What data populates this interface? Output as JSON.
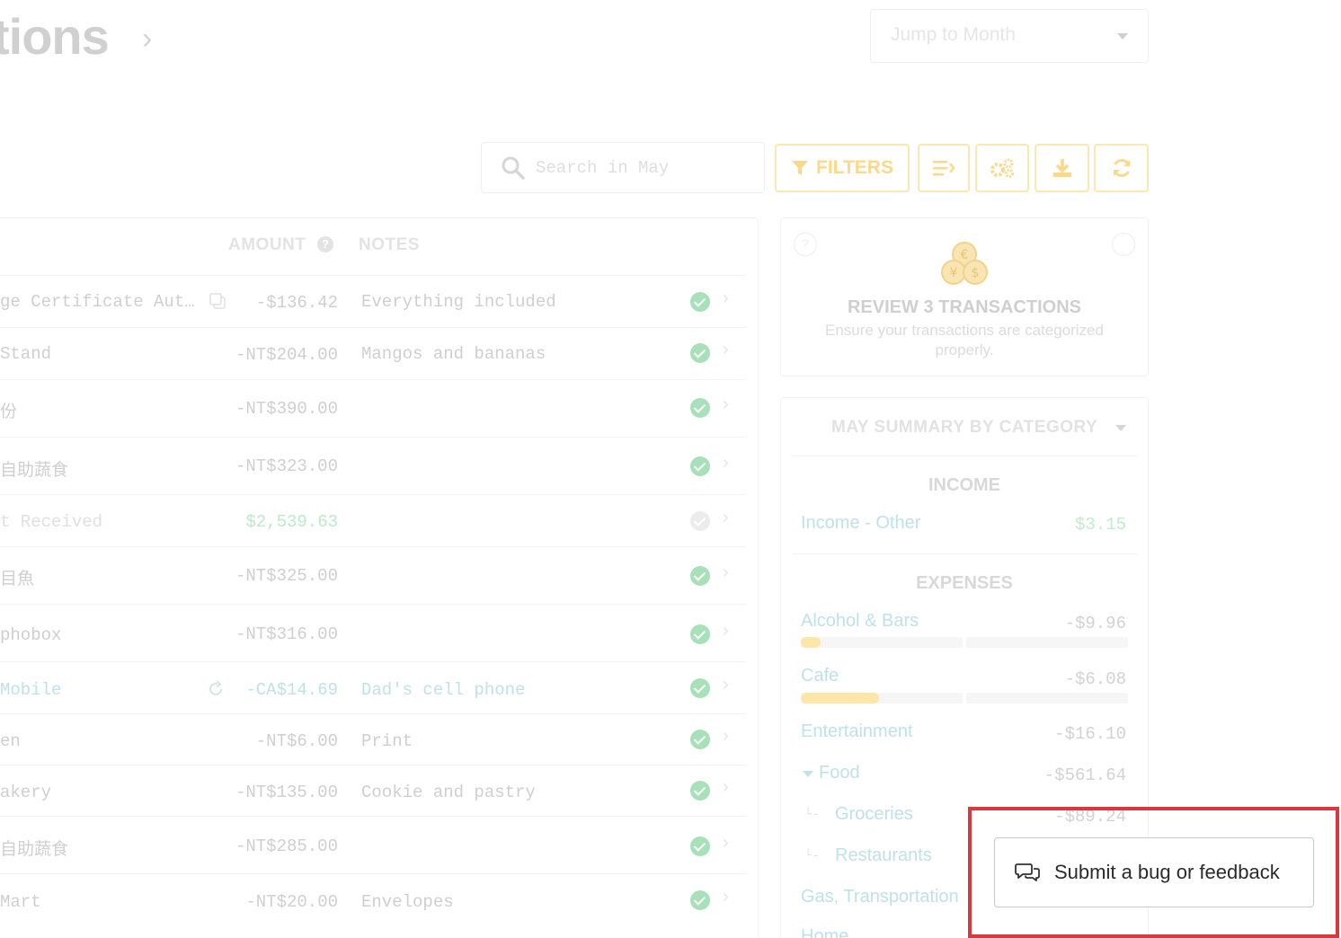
{
  "header": {
    "title_fragment": "tions",
    "jump_placeholder": "Jump to Month"
  },
  "toolbar": {
    "search_placeholder": "Search in May",
    "filters_label": "FILTERS",
    "accent_color": "#fcd98a"
  },
  "table": {
    "col_amount": "AMOUNT",
    "col_notes": "NOTES",
    "rows": [
      {
        "payee": "ge Certificate Aut…",
        "amount": "-$136.42",
        "notes": "Everything included",
        "status": "reviewed"
      },
      {
        "payee": "Stand",
        "amount": "-NT$204.00",
        "notes": "Mangos and bananas",
        "status": "reviewed"
      },
      {
        "payee": "份",
        "amount": "-NT$390.00",
        "notes": "",
        "status": "reviewed"
      },
      {
        "payee": "自助蔬食",
        "amount": "-NT$323.00",
        "notes": "",
        "status": "reviewed"
      },
      {
        "payee": "t Received",
        "amount": "$2,539.63",
        "notes": "",
        "status": "pending"
      },
      {
        "payee": "目魚",
        "amount": "-NT$325.00",
        "notes": "",
        "status": "reviewed"
      },
      {
        "payee": "phobox",
        "amount": "-NT$316.00",
        "notes": "",
        "status": "reviewed"
      },
      {
        "payee": " Mobile",
        "amount": "-CA$14.69",
        "notes": "Dad's cell phone",
        "status": "reviewed"
      },
      {
        "payee": "en",
        "amount": "-NT$6.00",
        "notes": "Print",
        "status": "reviewed"
      },
      {
        "payee": "akery",
        "amount": "-NT$135.00",
        "notes": "Cookie and pastry",
        "status": "reviewed"
      },
      {
        "payee": "自助蔬食",
        "amount": "-NT$285.00",
        "notes": "",
        "status": "reviewed"
      },
      {
        "payee": " Mart",
        "amount": "-NT$20.00",
        "notes": "Envelopes",
        "status": "reviewed"
      }
    ]
  },
  "review": {
    "title": "REVIEW 3 TRANSACTIONS",
    "subtitle": "Ensure your transactions are categorized properly."
  },
  "summary": {
    "title": "MAY SUMMARY BY CATEGORY",
    "income_heading": "INCOME",
    "income": [
      {
        "name": "Income - Other",
        "value": "$3.15"
      }
    ],
    "expenses_heading": "EXPENSES",
    "expenses": [
      {
        "name": "Alcohol & Bars",
        "value": "-$9.96",
        "progress": 0.06
      },
      {
        "name": "Cafe",
        "value": "-$6.08",
        "progress": 0.24
      },
      {
        "name": "Entertainment",
        "value": "-$16.10"
      },
      {
        "name": "Food",
        "value": "-$561.64"
      },
      {
        "name": "Groceries",
        "value": "-$89.24"
      },
      {
        "name": "Restaurants",
        "value": ""
      },
      {
        "name": "Gas, Transportation",
        "value": ""
      },
      {
        "name": "Home",
        "value": ""
      }
    ]
  },
  "feedback": {
    "label": "Submit a bug or feedback",
    "highlight_color": "#d9383c"
  }
}
